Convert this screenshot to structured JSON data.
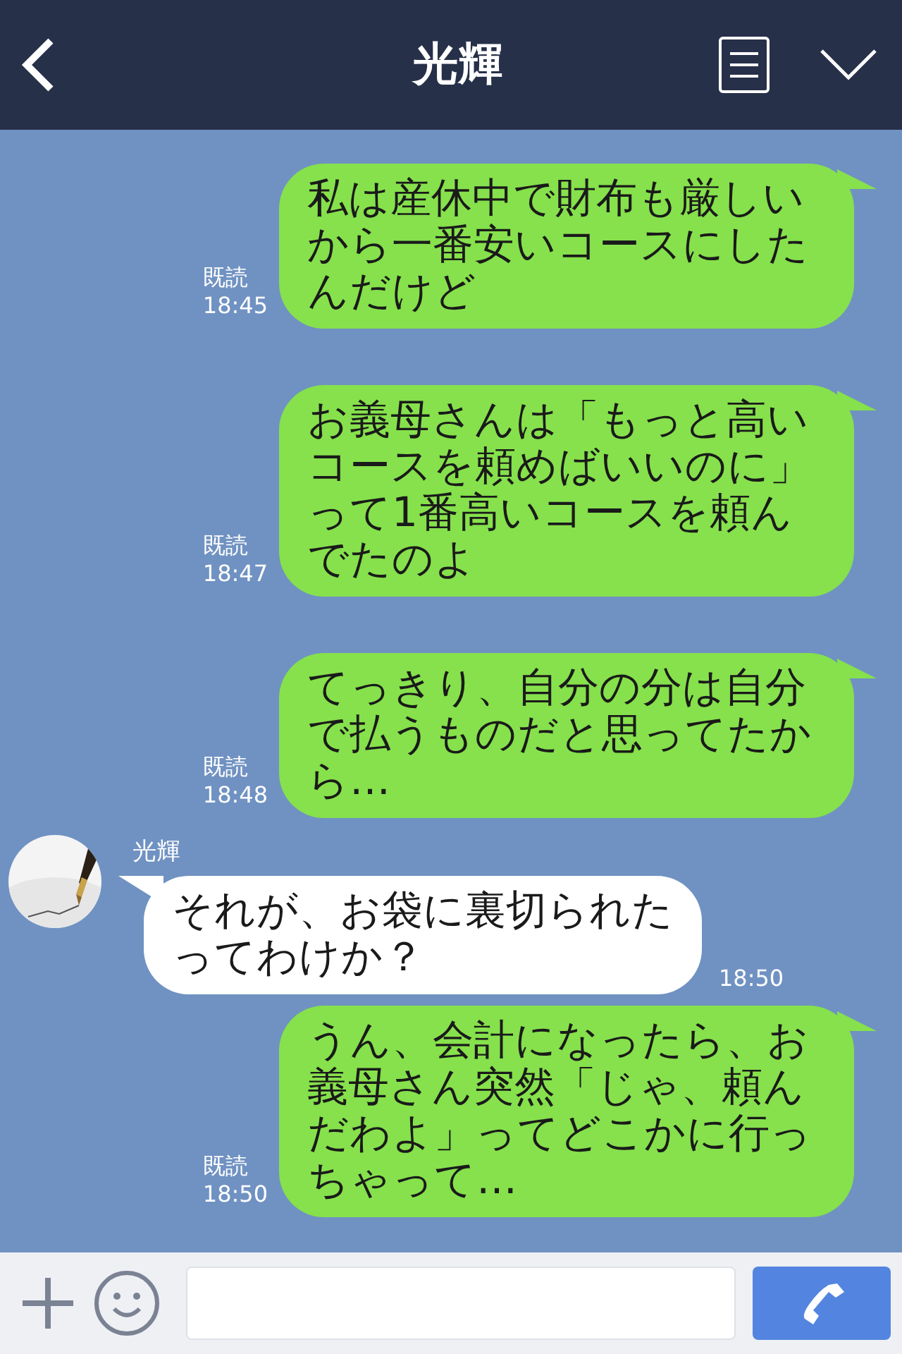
{
  "header": {
    "title": "光輝"
  },
  "messages": [
    {
      "kind": "sent",
      "text": "私は産休中で財布も厳しいから一番安いコースにしたんだけど",
      "read": "既読",
      "time": "18:45"
    },
    {
      "kind": "sent",
      "text": "お義母さんは「もっと高いコースを頼めばいいのに」って1番高いコースを頼んでたのよ",
      "read": "既読",
      "time": "18:47"
    },
    {
      "kind": "sent",
      "text": "てっきり、自分の分は自分で払うものだと思ってたから…",
      "read": "既読",
      "time": "18:48"
    },
    {
      "kind": "received",
      "sender": "光輝",
      "text": "それが、お袋に裏切られたってわけか？",
      "time": "18:50"
    },
    {
      "kind": "sent",
      "text": "うん、会計になったら、お義母さん突然「じゃ、頼んだわよ」ってどこかに行っちゃって…",
      "read": "既読",
      "time": "18:50"
    }
  ]
}
